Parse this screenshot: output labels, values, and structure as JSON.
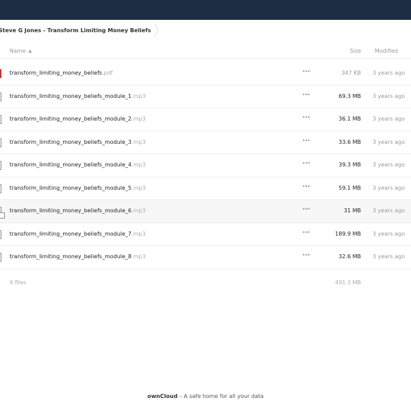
{
  "breadcrumb": {
    "folder": "Steve G Jones - Transform Limiting Money Beliefs"
  },
  "table": {
    "col_name": "Name",
    "col_size": "Size",
    "col_modified": "Modified"
  },
  "files": [
    {
      "base": "transform_limiting_money_beliefs",
      "ext": ".pdf",
      "size": "347 KB",
      "modified": "3 years ago",
      "actions": "•••"
    },
    {
      "base": "transform_limiting_money_beliefs_module_1",
      "ext": ".mp3",
      "size": "69.3 MB",
      "modified": "3 years ago",
      "actions": "•••"
    },
    {
      "base": "transform_limiting_money_beliefs_module_2",
      "ext": ".mp3",
      "size": "36.1 MB",
      "modified": "3 years ago",
      "actions": "•••"
    },
    {
      "base": "transform_limiting_money_beliefs_module_3",
      "ext": ".mp3",
      "size": "33.6 MB",
      "modified": "3 years ago",
      "actions": "•••"
    },
    {
      "base": "transform_limiting_money_beliefs_module_4",
      "ext": ".mp3",
      "size": "39.3 MB",
      "modified": "3 years ago",
      "actions": "•••"
    },
    {
      "base": "transform_limiting_money_beliefs_module_5",
      "ext": ".mp3",
      "size": "59.1 MB",
      "modified": "3 years ago",
      "actions": "•••"
    },
    {
      "base": "transform_limiting_money_beliefs_module_6",
      "ext": ".mp3",
      "size": "31 MB",
      "modified": "3 years ago",
      "actions": "•••"
    },
    {
      "base": "transform_limiting_money_beliefs_module_7",
      "ext": ".mp3",
      "size": "189.9 MB",
      "modified": "3 years ago",
      "actions": "•••"
    },
    {
      "base": "transform_limiting_money_beliefs_module_8",
      "ext": ".mp3",
      "size": "32.6 MB",
      "modified": "3 years ago",
      "actions": "•••"
    }
  ],
  "summary": {
    "count": "9 files",
    "total_size": "491.3 MB"
  },
  "footer": {
    "brand": "ownCloud",
    "tagline": " – A safe home for all your data"
  },
  "colors": {
    "header_bg": "#1d2d44",
    "pdf_icon": "#e9322d"
  }
}
